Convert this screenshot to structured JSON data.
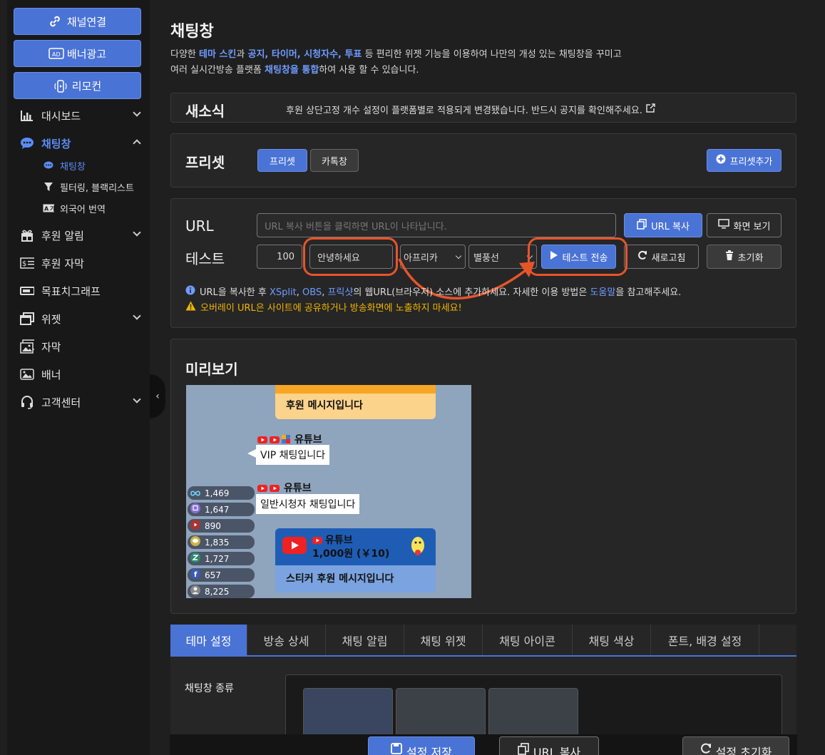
{
  "sidebar": {
    "top_buttons": [
      {
        "label": "채널연결",
        "icon": "link-icon"
      },
      {
        "label": "배너광고",
        "icon": "ad-icon"
      },
      {
        "label": "리모컨",
        "icon": "remote-icon"
      }
    ],
    "items": [
      {
        "label": "대시보드",
        "icon": "chart-icon"
      },
      {
        "label": "채팅창",
        "icon": "chat-icon"
      },
      {
        "label": "후원 알림",
        "icon": "gift-icon"
      },
      {
        "label": "후원 자막",
        "icon": "dollar-icon"
      },
      {
        "label": "목표치그래프",
        "icon": "battery-icon"
      },
      {
        "label": "위젯",
        "icon": "window-icon"
      },
      {
        "label": "자막",
        "icon": "image-icon"
      },
      {
        "label": "배너",
        "icon": "banner-icon"
      },
      {
        "label": "고객센터",
        "icon": "headset-icon"
      }
    ],
    "sub_items": [
      {
        "label": "채팅창",
        "icon": "chat-icon"
      },
      {
        "label": "필터링, 블랙리스트",
        "icon": "filter-icon"
      },
      {
        "label": "외국어 번역",
        "icon": "translate-icon"
      }
    ]
  },
  "page": {
    "title": "채팅창",
    "desc_line1": [
      "다양한 ",
      "테마 스킨",
      "과 ",
      "공지, 타이머, 시청자수, 투표",
      " 등 편리한 위젯 기능을 이용하여 나만의 개성 있는 채팅창을 꾸미고"
    ],
    "desc_line2": [
      "여러 실시간방송 플랫폼 ",
      "채팅창을 통합",
      "하여 사용 할 수 있습니다."
    ]
  },
  "news": {
    "title": "새소식",
    "text": "후원 상단고정 개수 설정이 플랫폼별로 적용되게 변경됐습니다. 반드시 공지를 확인해주세요."
  },
  "preset": {
    "title": "프리셋",
    "tabs": [
      "프리셋",
      "카톡창"
    ],
    "add_label": "프리셋추가"
  },
  "url_section": {
    "url_label": "URL",
    "url_placeholder": "URL 복사 버튼을 클릭하면 URL이 나타납니다.",
    "copy_label": "URL 복사",
    "view_label": "화면 보기",
    "test_label": "테스트",
    "amount": "100",
    "message": "안녕하세요",
    "platform": "아프리카",
    "type": "별풍선",
    "send_label": "테스트 전송",
    "refresh_label": "새로고침",
    "reset_label": "초기화",
    "info_parts": [
      "URL을 복사한 후 ",
      "XSplit",
      ", ",
      "OBS",
      ", ",
      "프릭샷",
      "의 웹URL(브라우저) 소스에 추가하세요. 자세한 이용 방법은 ",
      "도움말",
      "을 참고해주세요."
    ],
    "warning": "오버레이 URL은 사이트에 공유하거나 방송화면에 노출하지 마세요!"
  },
  "preview": {
    "title": "미리보기",
    "donation_msg": "후원 메시지입니다",
    "youtube": "유튜브",
    "vip_msg": "VIP 채팅입니다",
    "normal_msg": "일반시청자 채팅입니다",
    "sticker_amount": "1,000원 (￥10)",
    "sticker_msg": "스티커 후원 메시지입니다",
    "viewer_counts": [
      "1,469",
      "1,647",
      "890",
      "1,835",
      "1,727",
      "657",
      "8,225"
    ]
  },
  "tabs": [
    "테마 설정",
    "방송 상세",
    "채팅 알림",
    "채팅 위젯",
    "채팅 아이콘",
    "채팅 색상",
    "폰트, 배경 설정"
  ],
  "theme": {
    "label": "채팅창 종류"
  },
  "bottom": {
    "save": "설정 저장",
    "copy": "URL 복사",
    "reset": "설정 초기화"
  },
  "colors": {
    "accent": "#4a73d6",
    "highlight": "#e8542a",
    "warning": "#f0b400"
  }
}
